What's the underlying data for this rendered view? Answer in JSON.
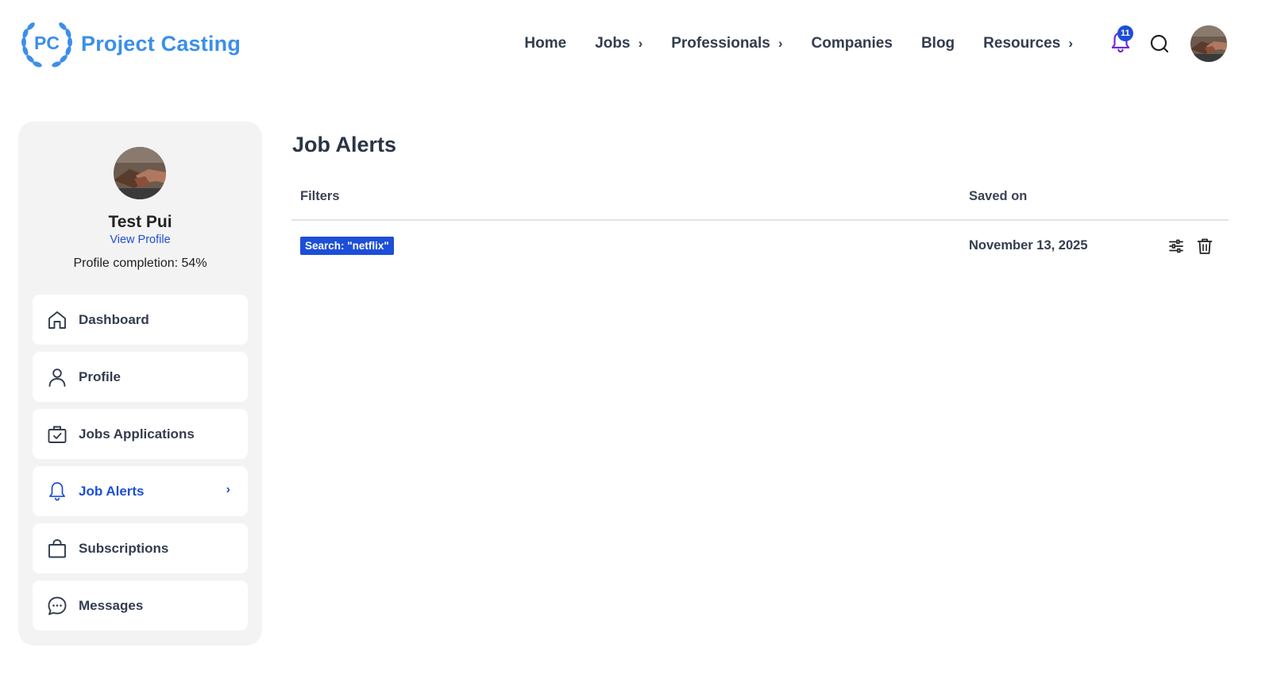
{
  "brand": {
    "logo_initials": "PC",
    "name": "Project Casting",
    "color": "#3b8fe8"
  },
  "nav": {
    "items": [
      {
        "label": "Home",
        "chevron": false
      },
      {
        "label": "Jobs",
        "chevron": true
      },
      {
        "label": "Professionals",
        "chevron": true
      },
      {
        "label": "Companies",
        "chevron": false
      },
      {
        "label": "Blog",
        "chevron": false
      },
      {
        "label": "Resources",
        "chevron": true
      }
    ],
    "chevron_glyph": "›",
    "notification_count": "11",
    "icons": [
      "bell-icon",
      "search-icon",
      "user-avatar"
    ]
  },
  "sidebar": {
    "user_name": "Test Pui",
    "view_profile_label": "View Profile",
    "completion_text": "Profile completion: 54%",
    "items": [
      {
        "label": "Dashboard",
        "icon": "home-icon",
        "active": false
      },
      {
        "label": "Profile",
        "icon": "user-icon",
        "active": false
      },
      {
        "label": "Jobs Applications",
        "icon": "briefcase-check-icon",
        "active": false
      },
      {
        "label": "Job Alerts",
        "icon": "bell-icon",
        "active": true
      },
      {
        "label": "Subscriptions",
        "icon": "shopping-bag-icon",
        "active": false
      },
      {
        "label": "Messages",
        "icon": "chat-bubble-icon",
        "active": false
      }
    ],
    "active_chevron": "›"
  },
  "main": {
    "title": "Job Alerts",
    "columns": {
      "filters": "Filters",
      "saved_on": "Saved on"
    },
    "rows": [
      {
        "filter_tag": "Search: \"netflix\"",
        "saved_on": "November 13, 2025",
        "actions": [
          "sliders-icon",
          "trash-icon"
        ]
      }
    ]
  },
  "colors": {
    "accent": "#1d4ed8",
    "sidebar_bg": "#f3f3f3",
    "text": "#333d4f"
  }
}
